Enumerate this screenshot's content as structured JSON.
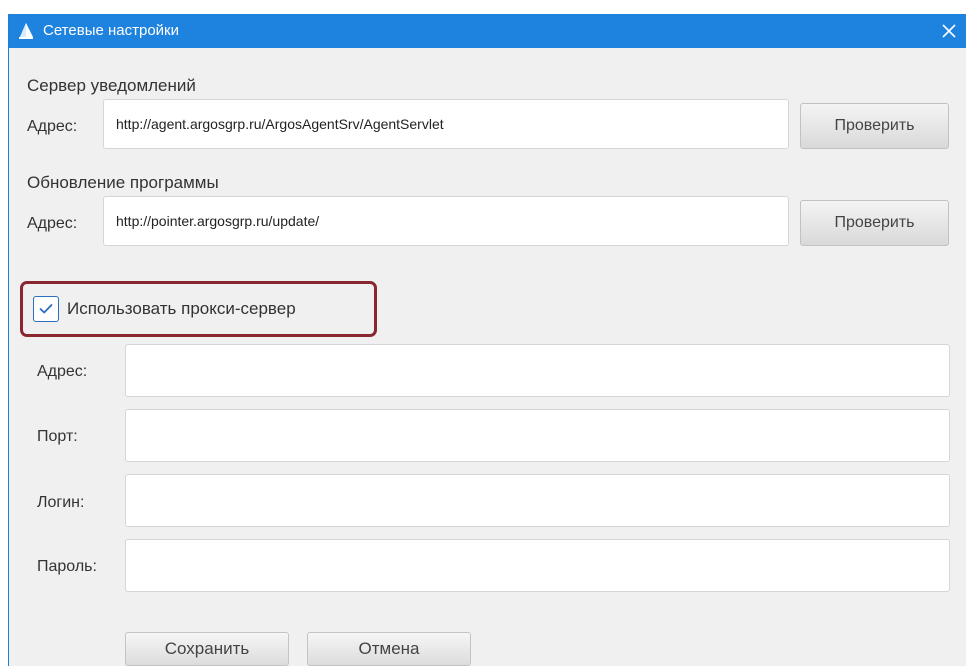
{
  "window": {
    "title": "Сетевые настройки",
    "title_icon": "sail-app-icon",
    "close_icon": "close-icon",
    "accent_color": "#1e83de",
    "highlight_color": "#8a2630"
  },
  "notification_server": {
    "section_label": "Сервер уведомлений",
    "address_label": "Адрес:",
    "address_value": "http://agent.argosgrp.ru/ArgosAgentSrv/AgentServlet",
    "check_button_label": "Проверить"
  },
  "program_update": {
    "section_label": "Обновление программы",
    "address_label": "Адрес:",
    "address_value": "http://pointer.argosgrp.ru/update/",
    "check_button_label": "Проверить"
  },
  "proxy": {
    "use_proxy_label": "Использовать прокси-сервер",
    "use_proxy_checked": true,
    "address_label": "Адрес:",
    "address_value": "",
    "port_label": "Порт:",
    "port_value": "",
    "login_label": "Логин:",
    "login_value": "",
    "password_label": "Пароль:",
    "password_value": ""
  },
  "actions": {
    "save_label": "Сохранить",
    "cancel_label": "Отмена"
  }
}
